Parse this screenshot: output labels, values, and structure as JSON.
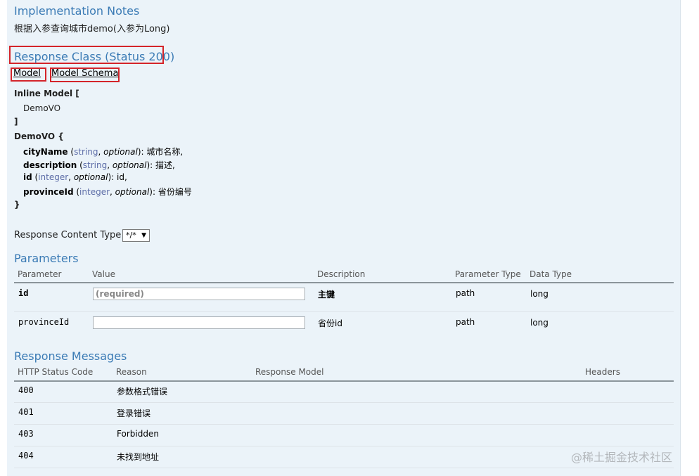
{
  "implementation": {
    "title": "Implementation Notes",
    "note": "根据入参查询城市demo(入参为Long)"
  },
  "response_class": {
    "title": "Response Class (Status 200)",
    "tabs": [
      "Model",
      "Model Schema"
    ]
  },
  "model": {
    "inline_open": "Inline Model [",
    "inline_item": "DemoVO",
    "inline_close": "]",
    "demo_open": "DemoVO {",
    "fields": [
      {
        "name": "cityName",
        "type": "string",
        "opt": "optional",
        "desc": "城市名称,"
      },
      {
        "name": "description",
        "type": "string",
        "opt": "optional",
        "desc": "描述,"
      },
      {
        "name": "id",
        "type": "integer",
        "opt": "optional",
        "desc": "id,"
      },
      {
        "name": "provinceId",
        "type": "integer",
        "opt": "optional",
        "desc": "省份编号"
      }
    ],
    "demo_close": "}"
  },
  "content_type": {
    "label": "Response Content Type",
    "value": "*/*"
  },
  "parameters": {
    "title": "Parameters",
    "headers": [
      "Parameter",
      "Value",
      "Description",
      "Parameter Type",
      "Data Type"
    ],
    "rows": [
      {
        "name": "id",
        "placeholder": "(required)",
        "value": "",
        "desc": "主键",
        "ptype": "path",
        "dtype": "long"
      },
      {
        "name": "provinceId",
        "placeholder": "",
        "value": "",
        "desc": "省份id",
        "ptype": "path",
        "dtype": "long"
      }
    ]
  },
  "response_messages": {
    "title": "Response Messages",
    "headers": [
      "HTTP Status Code",
      "Reason",
      "Response Model",
      "Headers"
    ],
    "rows": [
      {
        "code": "400",
        "reason": "参数格式错误"
      },
      {
        "code": "401",
        "reason": "登录错误"
      },
      {
        "code": "403",
        "reason": "Forbidden"
      },
      {
        "code": "404",
        "reason": "未找到地址"
      }
    ]
  },
  "watermark": "@稀土掘金技术社区"
}
